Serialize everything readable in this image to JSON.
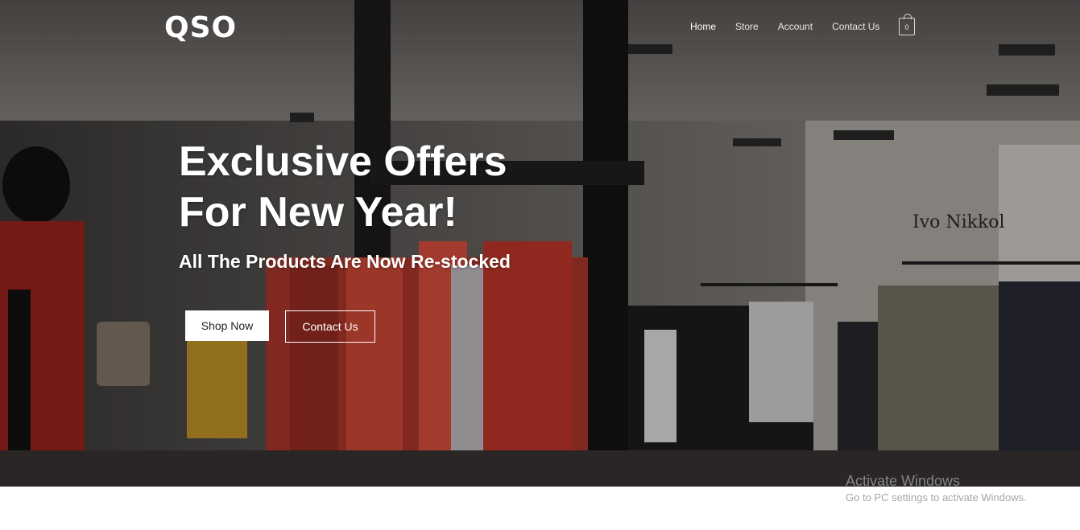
{
  "header": {
    "logo_text": "QSO",
    "nav": [
      {
        "label": "Home",
        "active": true
      },
      {
        "label": "Store",
        "active": false
      },
      {
        "label": "Account",
        "active": false
      },
      {
        "label": "Contact Us",
        "active": false
      }
    ],
    "cart_count": "0"
  },
  "hero": {
    "headline_line1": "Exclusive Offers",
    "headline_line2": "For New Year!",
    "subheading": "All The Products Are Now Re-stocked",
    "shop_button": "Shop Now",
    "contact_button": "Contact Us",
    "store_sign": "Ivo Nikkol"
  },
  "watermark": {
    "title": "Activate Windows",
    "subtitle": "Go to PC settings to activate Windows."
  },
  "colors": {
    "text": "#ffffff",
    "button_bg": "#ffffff",
    "button_text": "#222222",
    "page_bg": "#ffffff"
  }
}
